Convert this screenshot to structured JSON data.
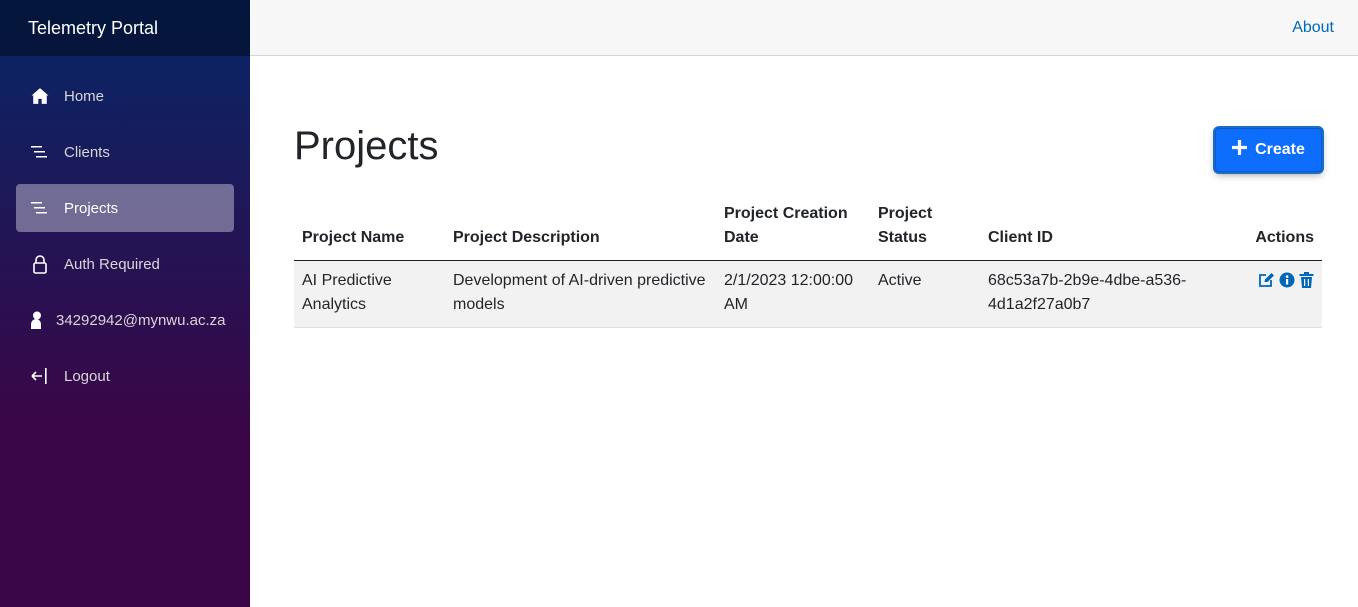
{
  "app": {
    "title": "Telemetry Portal"
  },
  "topbar": {
    "about_label": "About"
  },
  "sidebar": {
    "items": [
      {
        "label": "Home",
        "icon": "home-icon"
      },
      {
        "label": "Clients",
        "icon": "list-icon"
      },
      {
        "label": "Projects",
        "icon": "list-icon",
        "active": true
      },
      {
        "label": "Auth Required",
        "icon": "lock-icon"
      },
      {
        "label": "34292942@mynwu.ac.za",
        "icon": "person-icon"
      },
      {
        "label": "Logout",
        "icon": "logout-icon"
      }
    ]
  },
  "page": {
    "title": "Projects",
    "create_label": "Create"
  },
  "table": {
    "headers": [
      "Project Name",
      "Project Description",
      "Project Creation Date",
      "Project Status",
      "Client ID",
      "Actions"
    ],
    "rows": [
      {
        "name": "AI Predictive Analytics",
        "description": "Development of AI-driven predictive models",
        "created": "2/1/2023 12:00:00 AM",
        "status": "Active",
        "client_id": "68c53a7b-2b9e-4dbe-a536-4d1a2f27a0b7"
      }
    ]
  },
  "colors": {
    "sidebar_top": "#052767",
    "sidebar_bottom": "#3a0647",
    "primary": "#0d6efd",
    "link": "#006bb7",
    "action_icon": "#0067b8"
  }
}
